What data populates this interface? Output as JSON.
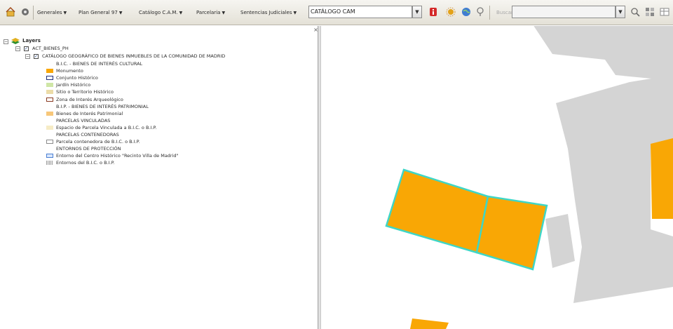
{
  "toolbar": {
    "menus": [
      {
        "label": "Generales"
      },
      {
        "label": "Plan General 97"
      },
      {
        "label": "Catálogo C.A.M."
      },
      {
        "label": "Parcelaria"
      },
      {
        "label": "Sentencias Judiciales"
      }
    ],
    "layer_combo_value": "CATÁLOGO CAM",
    "search_label": "Buscar"
  },
  "layers": {
    "root_label": "Layers",
    "group_label": "ACT_BIENES_PH",
    "catalog_label": "CATÁLOGO GEOGRÁFICO DE BIENES INMUEBLES DE LA COMUNIDAD DE MADRID",
    "items": [
      {
        "label": "B.I.C. - BIENES DE INTERÉS CULTURAL",
        "symbol": "none"
      },
      {
        "label": "Monumento",
        "symbol": "fill-orange"
      },
      {
        "label": "Conjunto Histórico",
        "symbol": "outline-navy"
      },
      {
        "label": "Jardín Histórico",
        "symbol": "fill-lightgreen"
      },
      {
        "label": "Sitio o Territorio Histórico",
        "symbol": "fill-beige"
      },
      {
        "label": "Zona de Interés Arqueológico",
        "symbol": "outline-brown"
      },
      {
        "label": "B.I.P. - BIENES DE INTERÉS PATRIMONIAL",
        "symbol": "none"
      },
      {
        "label": "Bienes de Interés Patrimonial",
        "symbol": "fill-lightorange"
      },
      {
        "label": "PARCELAS VINCULADAS",
        "symbol": "none"
      },
      {
        "label": "Espacio de Parcela Vinculada a B.I.C. o B.I.P.",
        "symbol": "fill-paleyellow"
      },
      {
        "label": "PARCELAS CONTENEDORAS",
        "symbol": "none"
      },
      {
        "label": "Parcela contenedora de B.I.C. o B.I.P.",
        "symbol": "outline-grey"
      },
      {
        "label": "ENTORNOS DE PROTECCIÓN",
        "symbol": "none"
      },
      {
        "label": "Entorno del Centro Histórico \"Recinto Villa de Madrid\"",
        "symbol": "outline-blue"
      },
      {
        "label": "Entornos del B.I.C. o B.I.P.",
        "symbol": "hatch-grey"
      }
    ]
  },
  "colors": {
    "monumento_fill": "#f9a705",
    "outline_cyan": "#3fd6c6",
    "building_grey": "#d4d4d4",
    "conjunto_navy": "#1f2f7a",
    "zona_brown": "#8a3b22",
    "entorno_blue": "#4a7fd4"
  },
  "icons": [
    "home-icon",
    "gear-icon",
    "info-red-icon",
    "sun-icon",
    "globe-icon",
    "pin-icon",
    "zoom-icon",
    "grid-icon"
  ]
}
